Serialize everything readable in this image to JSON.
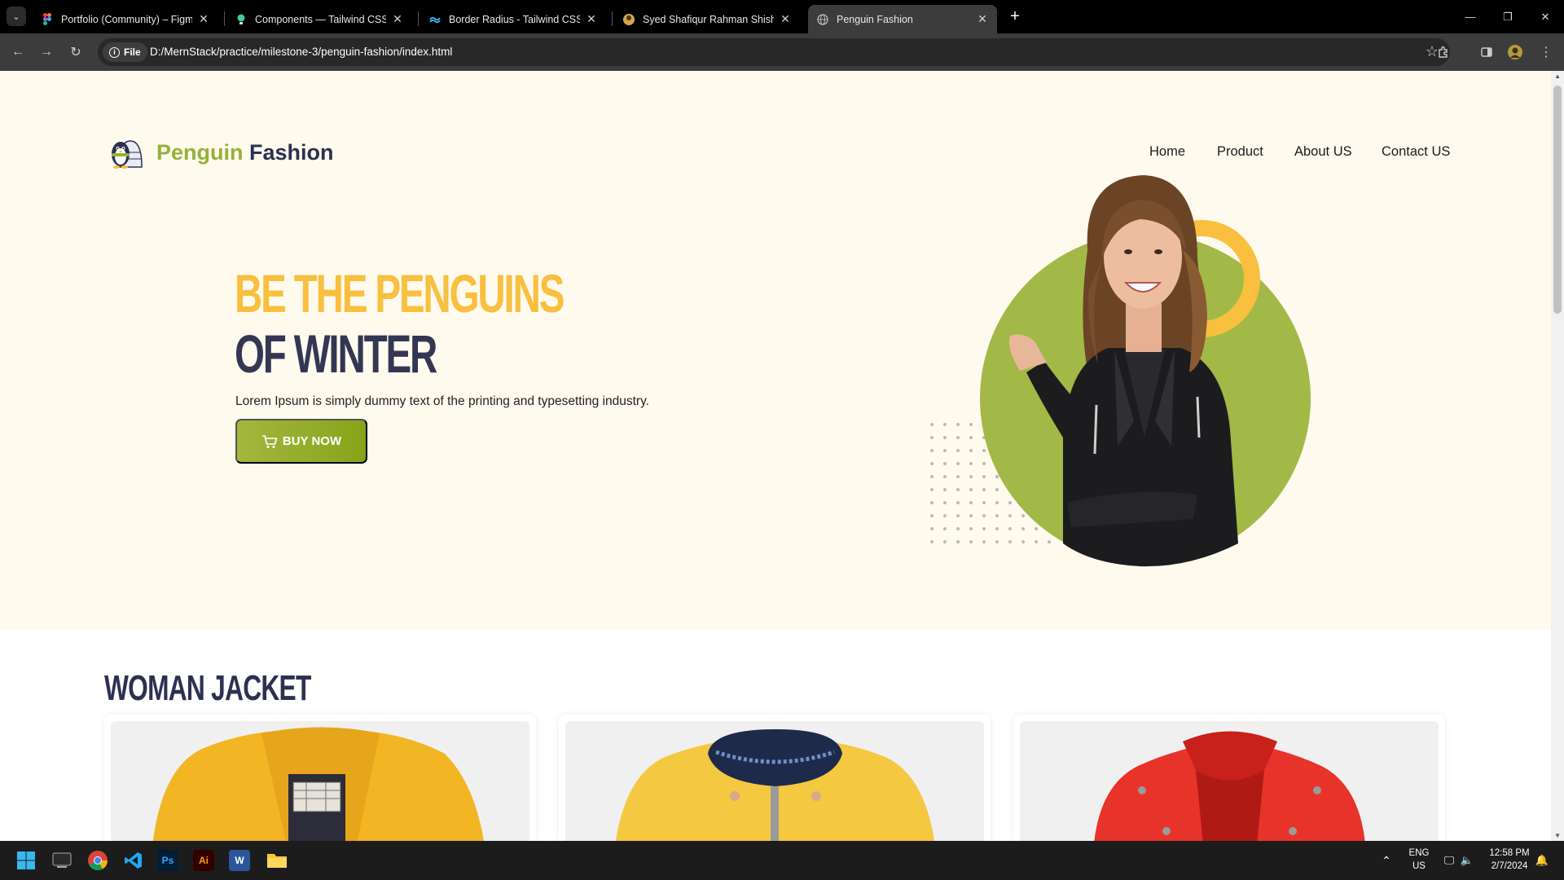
{
  "browser": {
    "tabs": [
      {
        "title": "Portfolio (Community) – Figma",
        "icon": "figma-icon"
      },
      {
        "title": "Components — Tailwind CSS Co",
        "icon": "bulb-icon"
      },
      {
        "title": "Border Radius - Tailwind CSS",
        "icon": "tailwind-icon"
      },
      {
        "title": "Syed Shafiqur Rahman Shishir-F",
        "icon": "avatar-icon"
      },
      {
        "title": "Penguin Fashion",
        "icon": "globe-icon"
      }
    ],
    "active_tab": 4,
    "address": {
      "chip": "File",
      "url": "D:/MernStack/practice/milestone-3/penguin-fashion/index.html"
    }
  },
  "page": {
    "brand": {
      "first": "Penguin",
      "second": "Fashion"
    },
    "nav": [
      "Home",
      "Product",
      "About US",
      "Contact US"
    ],
    "hero": {
      "line1": "BE THE PENGUINS",
      "line2": "OF WINTER",
      "text": "Lorem Ipsum is simply dummy text of the printing and typesetting industry.",
      "cta": "BUY NOW"
    },
    "section_title": "WOMAN JACKET",
    "colors": {
      "accent_green": "#97b13a",
      "accent_yellow": "#f9bf3e",
      "navy": "#2d3150",
      "hero_bg": "#fffaee"
    },
    "cards": [
      {
        "image": "yellow-coat"
      },
      {
        "image": "yellow-rain-jacket"
      },
      {
        "image": "red-leather-jacket"
      }
    ]
  },
  "taskbar": {
    "apps": [
      "windows-start-icon",
      "terminal-icon",
      "chrome-icon",
      "vscode-icon",
      "photoshop-icon",
      "illustrator-icon",
      "word-icon",
      "file-explorer-icon"
    ],
    "app_labels": {
      "photoshop": "Ps",
      "illustrator": "Ai",
      "word": "W"
    },
    "lang": {
      "line1": "ENG",
      "line2": "US"
    },
    "clock": {
      "time": "12:58 PM",
      "date": "2/7/2024"
    }
  }
}
